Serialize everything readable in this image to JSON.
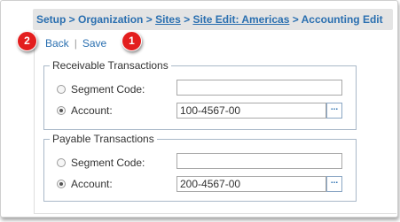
{
  "breadcrumb": {
    "setup": "Setup",
    "sep1": " > ",
    "organization": "Organization",
    "sep2": " > ",
    "sites": "Sites",
    "sep3": " > ",
    "site_edit": "Site Edit: Americas",
    "sep4": " > ",
    "current": "Accounting Edit"
  },
  "actions": {
    "back": "Back",
    "pipe": "|",
    "save": "Save"
  },
  "callouts": {
    "save_number": "1",
    "back_number": "2"
  },
  "receivable": {
    "legend": "Receivable Transactions",
    "segment_label": "Segment Code:",
    "segment_value": "",
    "segment_checked": false,
    "account_label": "Account:",
    "account_value": "100-4567-00",
    "account_checked": true,
    "lookup_label": "..."
  },
  "payable": {
    "legend": "Payable Transactions",
    "segment_label": "Segment Code:",
    "segment_value": "",
    "segment_checked": false,
    "account_label": "Account:",
    "account_value": "200-4567-00",
    "account_checked": true,
    "lookup_label": "..."
  },
  "colors": {
    "link": "#2a6fb0",
    "callout": "#e31e1e",
    "breadcrumb_bg": "#e4e4e4",
    "fieldset_border": "#a9b8c8"
  }
}
